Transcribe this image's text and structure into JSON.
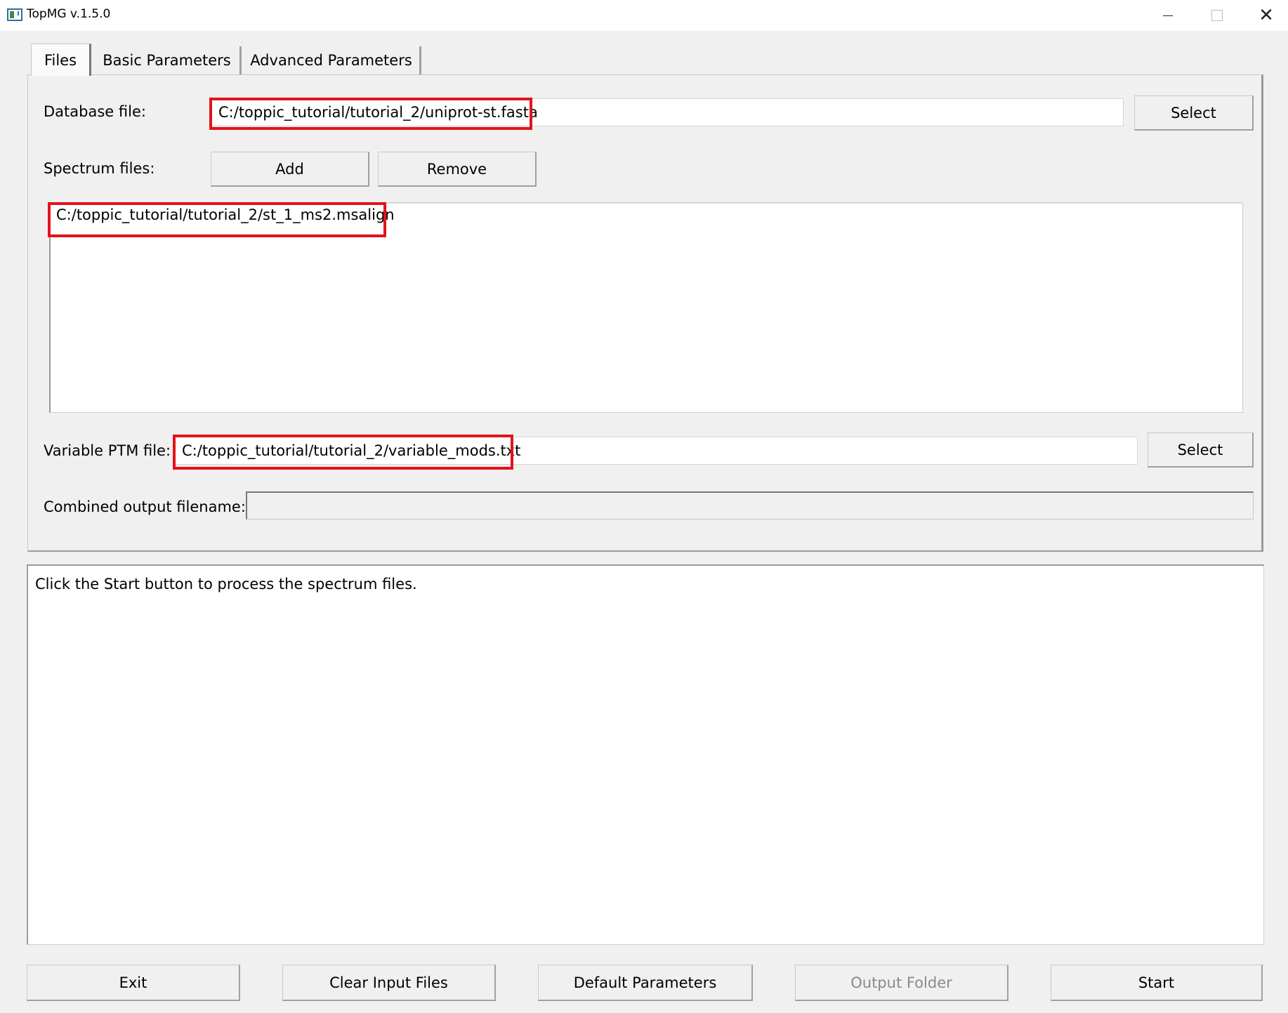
{
  "window": {
    "title": "TopMG v.1.5.0",
    "controls": [
      "minimize-icon",
      "maximize-icon",
      "close-icon"
    ]
  },
  "tabs": [
    {
      "label": "Files",
      "active": true
    },
    {
      "label": "Basic Parameters",
      "active": false
    },
    {
      "label": "Advanced Parameters",
      "active": false
    }
  ],
  "files": {
    "database": {
      "label": "Database file:",
      "value": "C:/toppic_tutorial/tutorial_2/uniprot-st.fasta",
      "select_label": "Select"
    },
    "spectrum": {
      "label": "Spectrum files:",
      "add_label": "Add",
      "remove_label": "Remove",
      "items": [
        "C:/toppic_tutorial/tutorial_2/st_1_ms2.msalign"
      ]
    },
    "ptm": {
      "label": "Variable PTM file:",
      "value": "C:/toppic_tutorial/tutorial_2/variable_mods.txt",
      "select_label": "Select"
    },
    "combined": {
      "label": "Combined output filename:",
      "value": ""
    }
  },
  "log": {
    "text": "Click the Start button to process the spectrum files."
  },
  "buttons": {
    "exit": "Exit",
    "clear": "Clear Input Files",
    "default": "Default Parameters",
    "output": "Output Folder",
    "start": "Start"
  },
  "colors": {
    "highlight": "#e3121b",
    "background": "#f0f0f0",
    "disabled_text": "#8a8a8a"
  }
}
